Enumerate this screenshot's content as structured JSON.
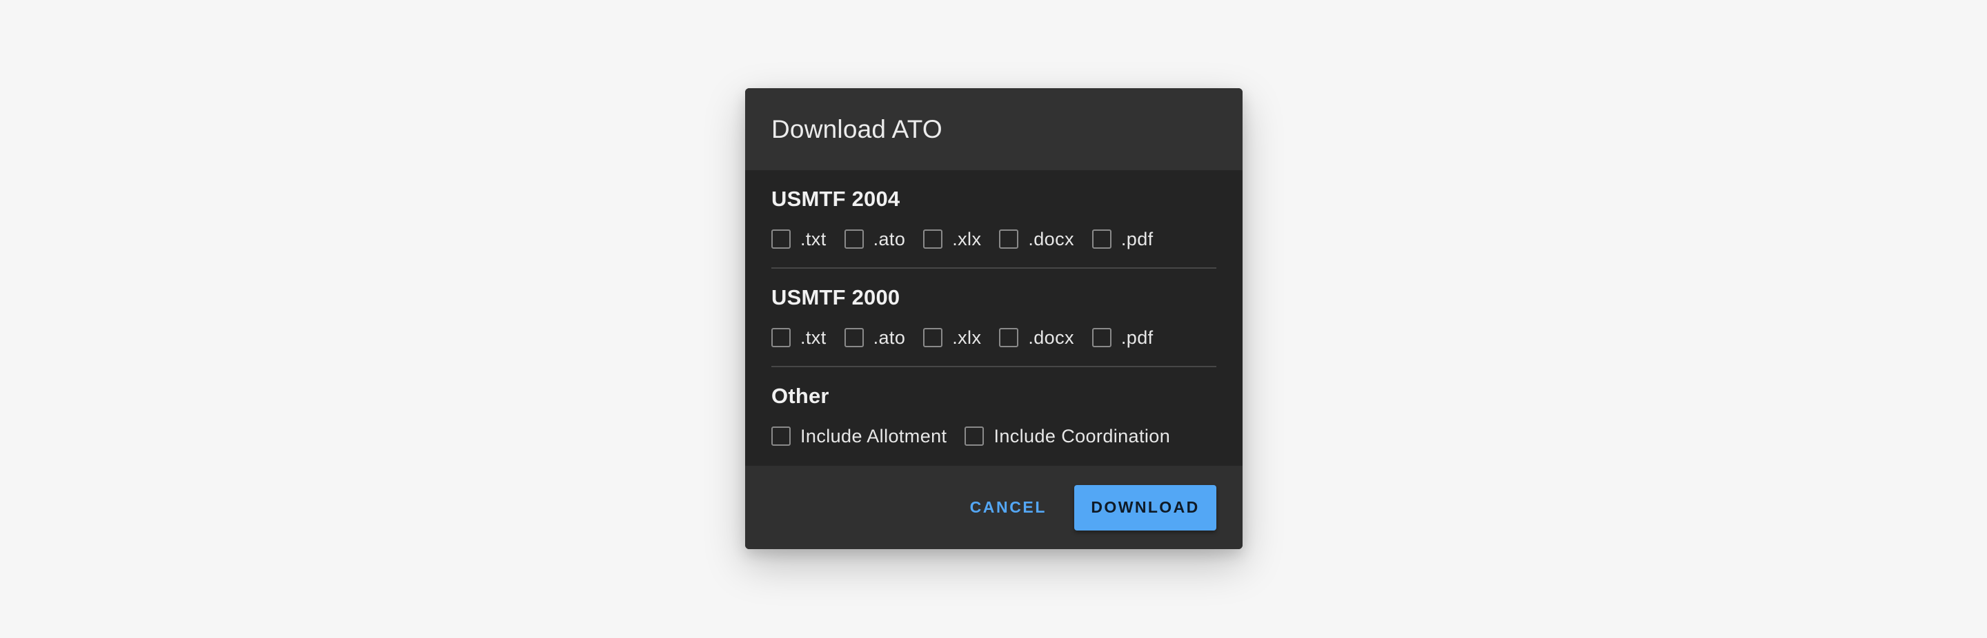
{
  "dialog": {
    "title": "Download ATO",
    "sections": [
      {
        "title": "USMTF 2004",
        "options": [
          ".txt",
          ".ato",
          ".xlx",
          ".docx",
          ".pdf"
        ]
      },
      {
        "title": "USMTF 2000",
        "options": [
          ".txt",
          ".ato",
          ".xlx",
          ".docx",
          ".pdf"
        ]
      },
      {
        "title": "Other",
        "options": [
          "Include Allotment",
          "Include Coordination"
        ]
      }
    ],
    "cancel_label": "CANCEL",
    "download_label": "DOWNLOAD"
  },
  "colors": {
    "backdrop": "#f6f6f6",
    "header": "#323232",
    "body": "#242424",
    "footer": "#303030",
    "accent": "#53a7f5"
  },
  "icons": {
    "checkbox": "checkbox-unchecked-icon"
  }
}
